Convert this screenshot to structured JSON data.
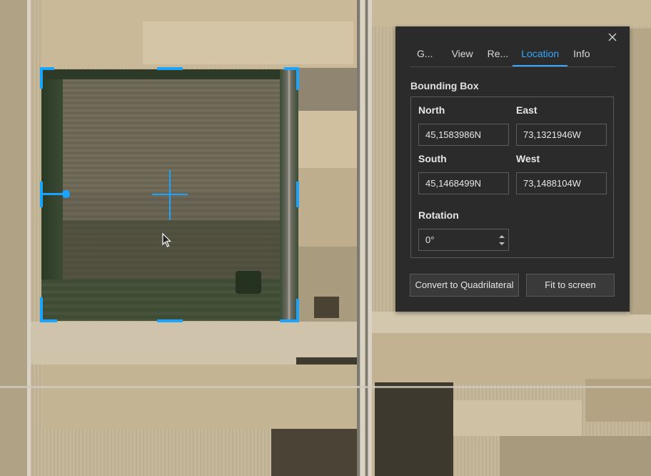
{
  "panel": {
    "tabs": [
      {
        "label": "G...",
        "active": false
      },
      {
        "label": "View",
        "active": false
      },
      {
        "label": "Re...",
        "active": false
      },
      {
        "label": "Location",
        "active": true
      },
      {
        "label": "Info",
        "active": false
      }
    ],
    "section_title": "Bounding Box",
    "north_label": "North",
    "north_value": "45,1583986N",
    "east_label": "East",
    "east_value": "73,1321946W",
    "south_label": "South",
    "south_value": "45,1468499N",
    "west_label": "West",
    "west_value": "73,1488104W",
    "rotation_label": "Rotation",
    "rotation_value": "0°",
    "convert_button": "Convert to Quadrilateral",
    "fit_button": "Fit to screen"
  },
  "icons": {
    "close": "close-icon",
    "spinner": "spinner-arrows-icon",
    "cursor": "mouse-pointer-icon"
  },
  "colors": {
    "accent": "#35a8ff",
    "handle": "#1aa3ff",
    "panel_bg": "#2b2b2b"
  }
}
